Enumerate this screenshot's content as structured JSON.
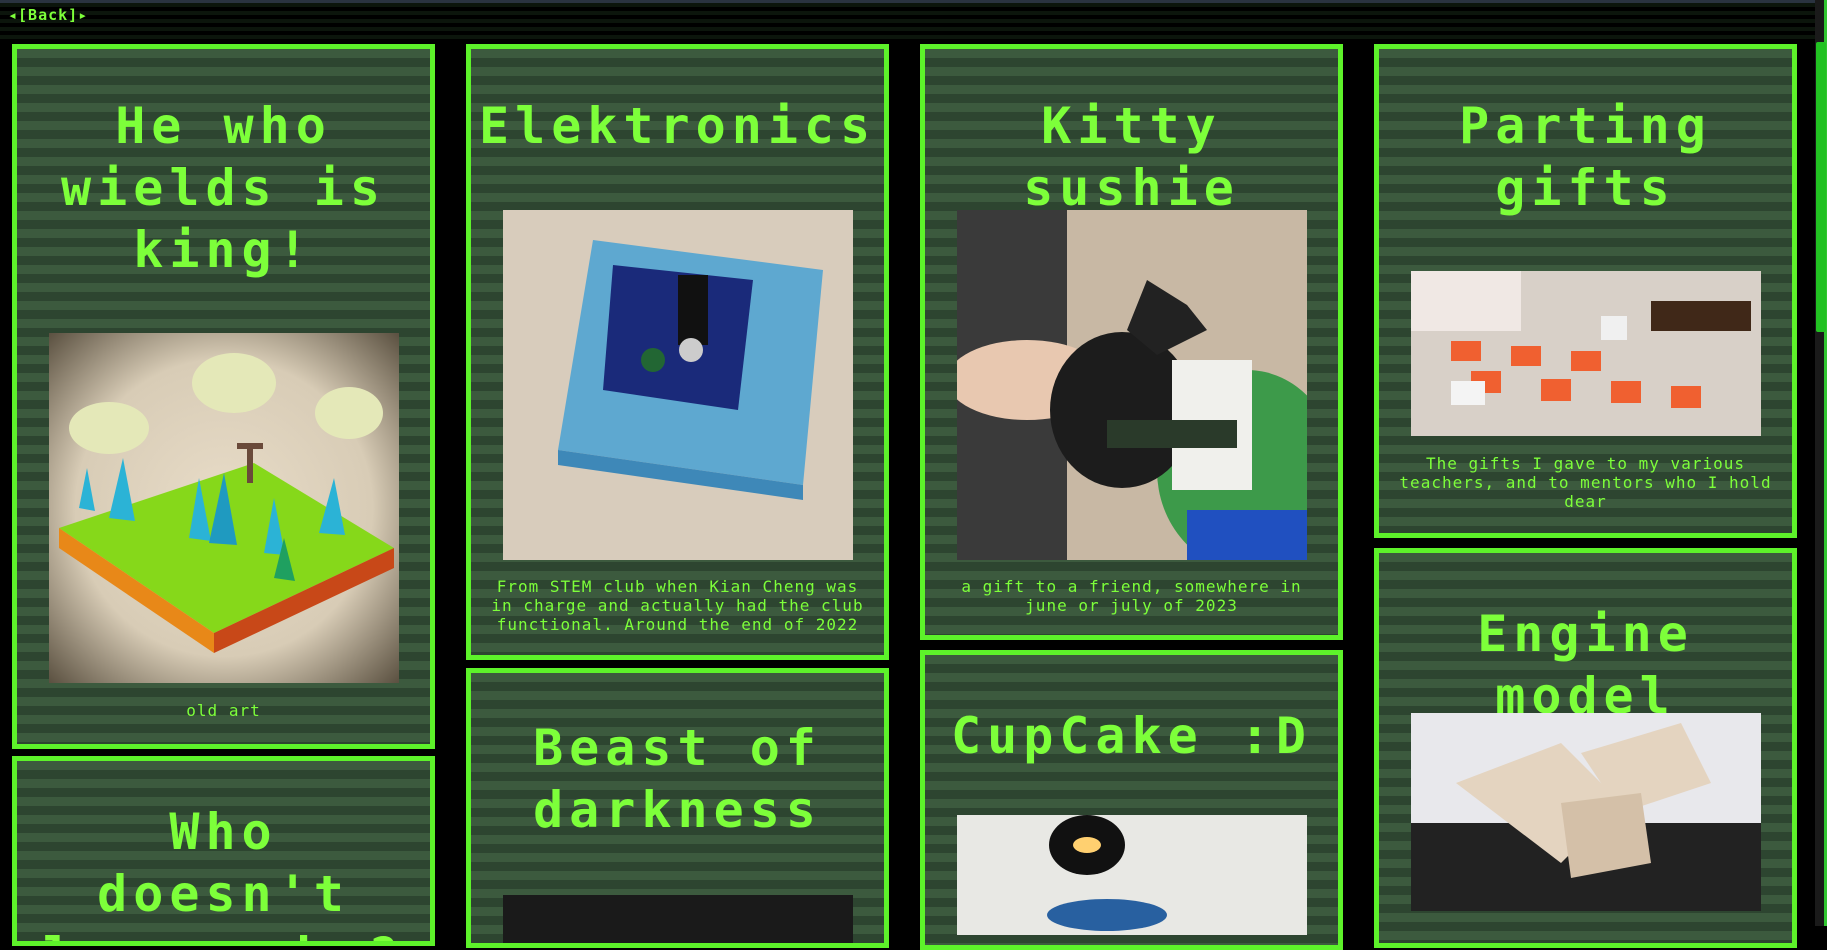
{
  "nav": {
    "back_label": "◂[Back]▸"
  },
  "colors": {
    "accent": "#5df22a",
    "text": "#7dff3a",
    "card_stripe_a": "#3c5a3e",
    "card_stripe_b": "#2d4530"
  },
  "cards": [
    {
      "title": "He who wields is king!",
      "caption": "old art",
      "image": "low-poly-island-sword-render"
    },
    {
      "title": "Elektronics",
      "caption": "From STEM club when Kian Cheng was in charge and actually had the club functional. Around the end of 2022",
      "image": "circuit-board-on-blue-foam"
    },
    {
      "title": "Kitty sushie",
      "caption": "a gift to a friend, somewhere in june or july of 2023",
      "image": "black-cat-figurine-on-white-block"
    },
    {
      "title": "Parting gifts",
      "caption": "The gifts I gave to my various teachers, and to mentors who I hold dear",
      "image": "row-of-gifts-on-orange-cards"
    },
    {
      "title": "Who doesn't love cake?",
      "caption": "",
      "image": "cake-photo"
    },
    {
      "title": "Beast of darkness",
      "caption": "",
      "image": "dark-beast-photo"
    },
    {
      "title": "CupCake :D",
      "caption": "",
      "image": "cupcake-photo"
    },
    {
      "title": "Engine model",
      "caption": "",
      "image": "v-engine-3d-print"
    }
  ]
}
